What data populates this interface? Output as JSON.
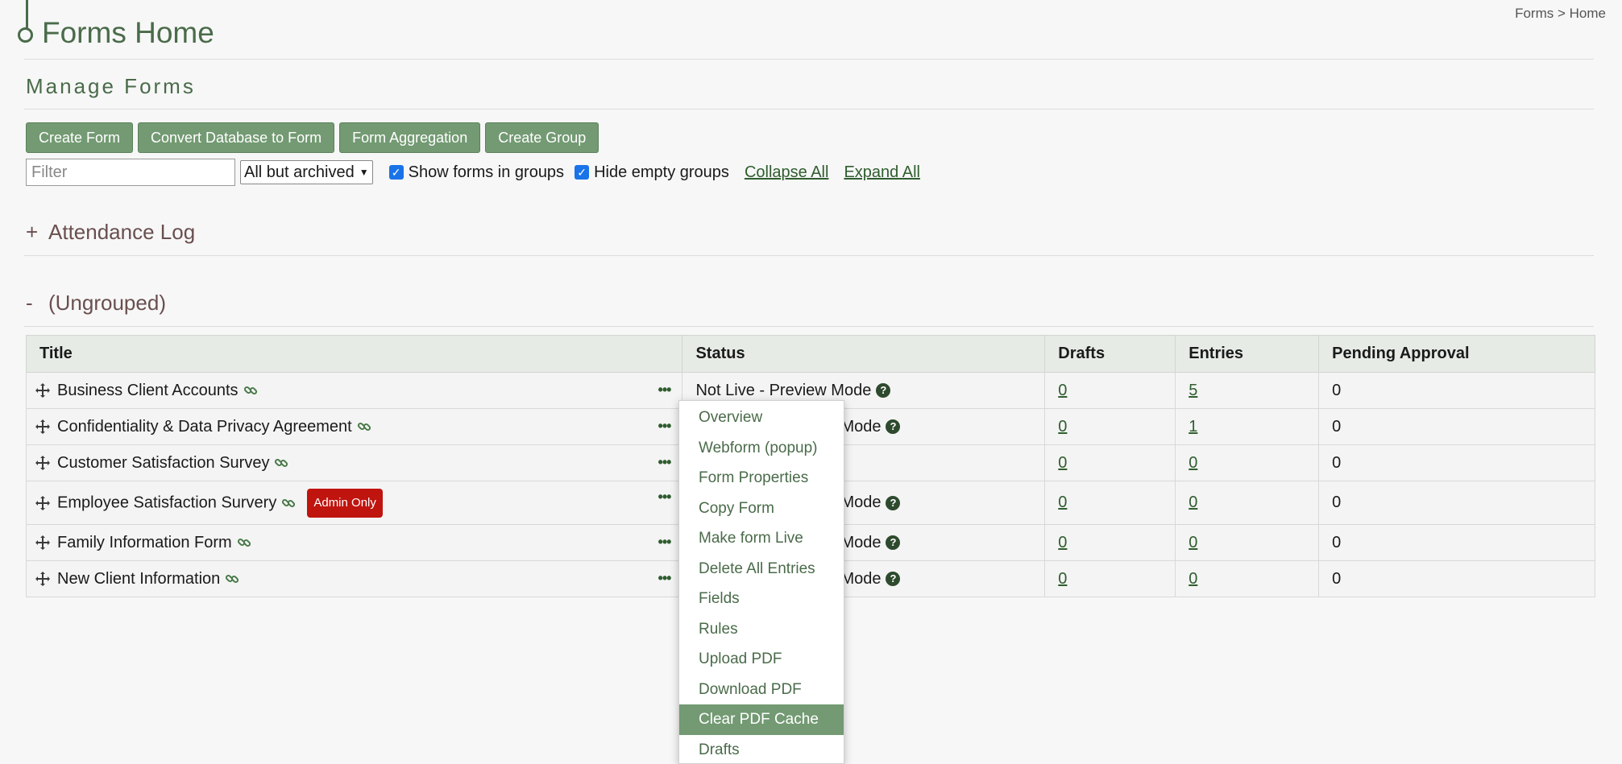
{
  "breadcrumb": {
    "root": "Forms",
    "sep": ">",
    "current": "Home"
  },
  "page": {
    "title": "Forms Home",
    "section_title": "Manage Forms"
  },
  "toolbar": {
    "create_form": "Create Form",
    "convert_db": "Convert Database to Form",
    "aggregation": "Form Aggregation",
    "create_group": "Create Group"
  },
  "filters": {
    "filter_placeholder": "Filter",
    "archive_select": "All but archived",
    "show_in_groups": "Show forms in groups",
    "hide_empty": "Hide empty groups",
    "collapse_all": "Collapse All",
    "expand_all": "Expand All"
  },
  "groups": [
    {
      "toggle": "+",
      "name": "Attendance Log"
    },
    {
      "toggle": "-",
      "name": "(Ungrouped)"
    }
  ],
  "table": {
    "headers": [
      "Title",
      "Status",
      "Drafts",
      "Entries",
      "Pending Approval"
    ],
    "rows": [
      {
        "title": "Business Client Accounts",
        "status": "Not Live - Preview Mode",
        "drafts": "0",
        "entries": "5",
        "pending": "0"
      },
      {
        "title": "Confidentiality & Data Privacy Agreement",
        "status": "Mode",
        "drafts": "0",
        "entries": "1",
        "pending": "0"
      },
      {
        "title": "Customer Satisfaction Survey",
        "status": "",
        "drafts": "0",
        "entries": "0",
        "pending": "0"
      },
      {
        "title": "Employee Satisfaction Survery",
        "badge": "Admin Only",
        "status": "Mode",
        "drafts": "0",
        "entries": "0",
        "pending": "0"
      },
      {
        "title": "Family Information Form",
        "status": "Mode",
        "drafts": "0",
        "entries": "0",
        "pending": "0"
      },
      {
        "title": "New Client Information",
        "status": "Mode",
        "drafts": "0",
        "entries": "0",
        "pending": "0"
      }
    ]
  },
  "menu": {
    "items": [
      "Overview",
      "Webform (popup)",
      "Form Properties",
      "Copy Form",
      "Make form Live",
      "Delete All Entries",
      "Fields",
      "Rules",
      "Upload PDF",
      "Download PDF",
      "Clear PDF Cache",
      "Drafts"
    ],
    "active": "Clear PDF Cache"
  },
  "colors": {
    "accent": "#739a73",
    "title_green": "#4a6b4a",
    "badge_red": "#c0140f",
    "group_brown": "#6a4f4f"
  }
}
